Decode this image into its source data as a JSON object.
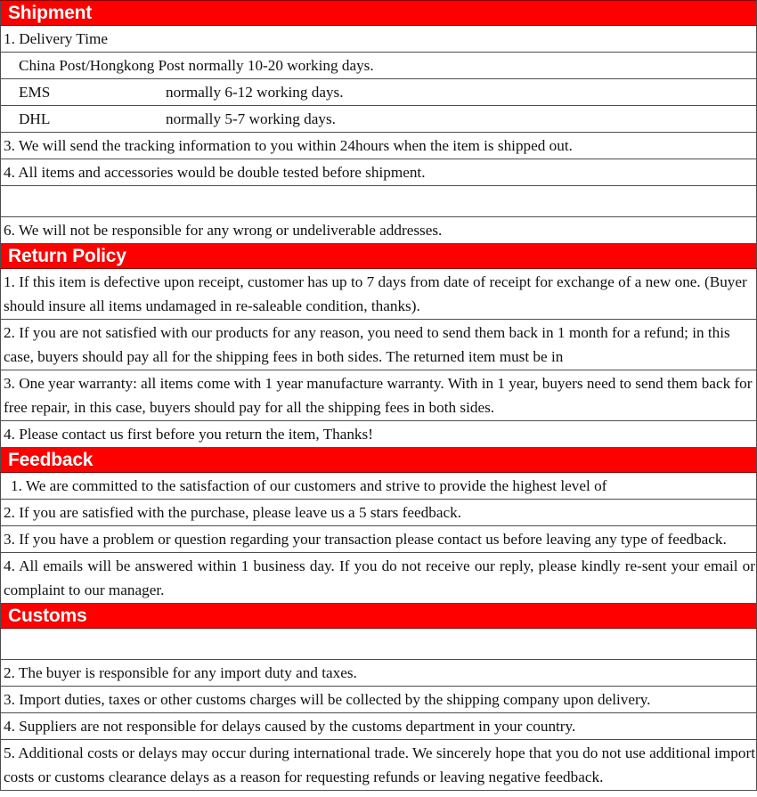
{
  "document": {
    "title": "Shipment / Return Policy / Feedback / Customs",
    "accent_color": "#ff0000",
    "header_text_color": "#ffffff",
    "border_color": "#4d4d4d"
  },
  "sections": {
    "shipment": {
      "heading": "Shipment",
      "item1": "1. Delivery Time",
      "method_china_post": "China Post/Hongkong Post normally 10-20 working days.",
      "method_ems_name": "EMS",
      "method_ems_time": "normally 6-12 working days.",
      "method_dhl_name": "DHL",
      "method_dhl_time": "normally 5-7 working days.",
      "item3": "3. We will send the tracking information to you within 24hours when the item is shipped out.",
      "item4": "4. All items and accessories would be double tested before shipment.",
      "blank_row": "",
      "item6": "6. We will not be responsible for any wrong or undeliverable addresses."
    },
    "return_policy": {
      "heading": "Return Policy",
      "item1": "1. If this item is defective upon receipt, customer has up to 7 days from date of receipt for exchange of a new one. (Buyer should insure all items undamaged in re-saleable condition, thanks).",
      "item2": "2. If you are not satisfied with our products for any reason, you need to send them back in 1 month for a refund; in this case, buyers should pay all for the shipping fees in both sides. The returned item must be in",
      "item3": "3. One year warranty: all items come with 1 year manufacture warranty. With in 1 year, buyers need to send them back for free repair, in this case, buyers should pay for all the shipping fees in both sides.",
      "item4": "4. Please contact us first before you return the item, Thanks!"
    },
    "feedback": {
      "heading": "Feedback",
      "item1": "1. We are committed to the satisfaction of our customers and strive to provide the highest level of",
      "item2": "2. If you are satisfied with the purchase, please leave us a 5 stars feedback.",
      "item3": "3. If you have a problem or question regarding your transaction please contact us before leaving any type of feedback.",
      "item4": "4. All emails will be answered within 1 business day. If you do not receive our reply, please kindly re-sent your email or complaint to our manager."
    },
    "customs": {
      "heading": "Customs",
      "blank_row": "",
      "item2": "2. The buyer is responsible for any import duty and taxes.",
      "item3": "3. Import duties, taxes or other customs charges will be collected by the shipping company upon delivery.",
      "item4": "4. Suppliers are not responsible for delays caused by the customs department in your country.",
      "item5": "5. Additional costs or delays may occur during international trade. We sincerely hope that you do not use additional import costs or customs clearance delays as a reason for requesting refunds or leaving negative feedback."
    }
  }
}
